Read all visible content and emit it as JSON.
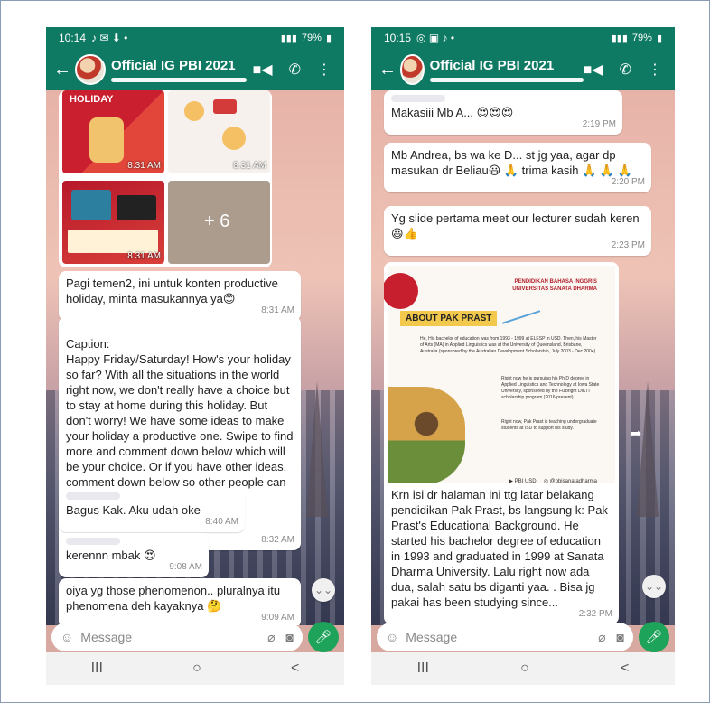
{
  "left": {
    "status": {
      "time": "10:14",
      "icons": "♪ ✉ ⬇ •",
      "battery": "79%"
    },
    "header": {
      "title": "Official IG PBI 2021"
    },
    "album": {
      "tile1_label": "HOLIDAY",
      "tile1_time": "8.31 AM",
      "tile2_time": "8.31 AM",
      "tile3_time": "8.31 AM",
      "more": "+ 6"
    },
    "messages": [
      {
        "text": "Pagi temen2, ini untuk konten productive holiday, minta masukannya ya😊",
        "time": "8:31 AM"
      },
      {
        "text": "Caption:\nHappy Friday/Saturday! How's your holiday so far? With all the situations in the world right now, we don't really have a choice but to stay at home during this holiday. But don't worry! We have some ideas to make your holiday a productive one. Swipe to find more and comment down below which will be your choice. Or if you have other ideas, comment down below so other people can also try it.\nHappy holiday 🥳",
        "time": "8:32 AM"
      },
      {
        "text": "Bagus Kak. Aku udah oke",
        "time": "8:40 AM"
      },
      {
        "text": "kerennn mbak 😍",
        "time": "9:08 AM"
      },
      {
        "text": "oiya yg those phenomenon.. pluralnya itu phenomena deh kayaknya 🤔",
        "time": "9:09 AM"
      }
    ],
    "input": {
      "placeholder": "Message"
    }
  },
  "right": {
    "status": {
      "time": "10:15",
      "icons": "◎ ▣ ♪ •",
      "battery": "79%"
    },
    "header": {
      "title": "Official IG PBI 2021"
    },
    "messages": [
      {
        "text": "Makasiii Mb A... 😍😍😍",
        "time": "2:19 PM"
      },
      {
        "text": "Mb Andrea, bs wa ke D... st jg yaa, agar dp masukan dr Beliau😃 🙏 trima kasih 🙏 🙏 🙏",
        "time": "2:20 PM"
      },
      {
        "text": "Yg slide pertama meet our lecturer sudah keren😃👍",
        "time": "2:23 PM"
      },
      {
        "text": "Krn isi dr halaman ini ttg latar belakang pendidikan Pak Prast, bs langsung k: Pak Prast's Educational Background. He started his bachelor degree of education in 1993 and graduated in 1999 at Sanata Dharma University. Lalu right now ada dua, salah satu bs diganti yaa. . Bisa jg pakai has been studying since...",
        "time": "2:32 PM"
      }
    ],
    "poster": {
      "header": "PENDIDIKAN BAHASA INGGRIS UNIVERSITAS SANATA DHARMA",
      "chip": "ABOUT PAK PRAST",
      "para1": "He, His bachelor of education was from 1993 - 1999 at ELESP in USD. Then, his Master of Arts (MA) in Applied Linguistics was at the University of Queensland, Brisbane, Australia (sponsored by the Australian Development Scholarship, July 2003 - Dec 2004).",
      "para2": "Right now he is pursuing his Ph.D degree in Applied Linguistics and Technology at Iowa State University, sponsored by the Fulbright DIKTI scholarship program (2016-present).",
      "para3": "Right now, Pak Prast is teaching undergraduate students at ISU to support his study.",
      "footer_yt": "▶ PBI USD",
      "footer_ig": "◎ @pbisanatadharma"
    },
    "input": {
      "placeholder": "Message"
    }
  },
  "nav": {
    "recents": "III",
    "home": "○",
    "back": "<"
  }
}
